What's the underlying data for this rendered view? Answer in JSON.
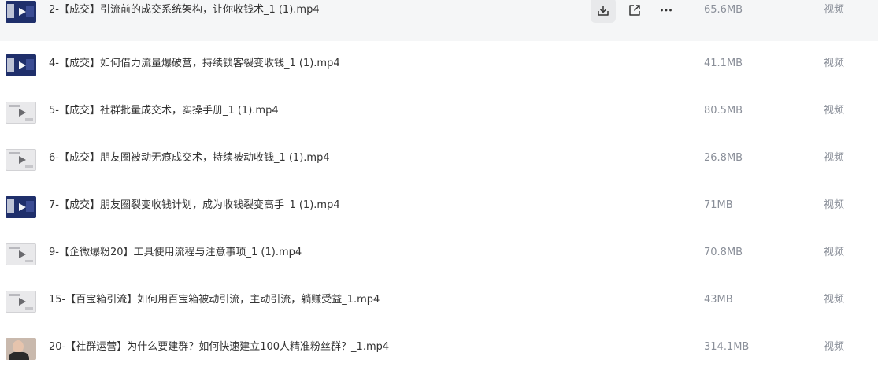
{
  "files": [
    {
      "name": "2-【成交】引流前的成交系统架构，让你收钱术_1 (1).mp4",
      "size": "65.6MB",
      "type": "视频",
      "thumb": "dark-video-thumbnail",
      "hovered": true
    },
    {
      "name": "4-【成交】如何借力流量爆破营，持续锁客裂变收钱_1 (1).mp4",
      "size": "41.1MB",
      "type": "视频",
      "thumb": "dark-video-thumbnail"
    },
    {
      "name": "5-【成交】社群批量成交术，实操手册_1 (1).mp4",
      "size": "80.5MB",
      "type": "视频",
      "thumb": "light-video-thumbnail"
    },
    {
      "name": "6-【成交】朋友圈被动无痕成交术，持续被动收钱_1 (1).mp4",
      "size": "26.8MB",
      "type": "视频",
      "thumb": "light-video-thumbnail"
    },
    {
      "name": "7-【成交】朋友圈裂变收钱计划，成为收钱裂变高手_1 (1).mp4",
      "size": "71MB",
      "type": "视频",
      "thumb": "dark-video-thumbnail"
    },
    {
      "name": "9-【企微爆粉20】工具使用流程与注意事项_1 (1).mp4",
      "size": "70.8MB",
      "type": "视频",
      "thumb": "light-video-thumbnail"
    },
    {
      "name": "15-【百宝箱引流】如何用百宝箱被动引流，主动引流，躺赚受益_1.mp4",
      "size": "43MB",
      "type": "视频",
      "thumb": "light-video-thumbnail"
    },
    {
      "name": "20-【社群运营】为什么要建群？如何快速建立100人精准粉丝群？_1.mp4",
      "size": "314.1MB",
      "type": "视频",
      "thumb": "photo-video-thumbnail"
    }
  ],
  "row_actions": {
    "download_icon": "download-icon",
    "share_icon": "share-icon",
    "more_icon": "more-icon"
  },
  "colors": {
    "hover_row_bg": "#f5f6f7",
    "primary_text": "#333333",
    "secondary_text": "#8a8f99"
  }
}
